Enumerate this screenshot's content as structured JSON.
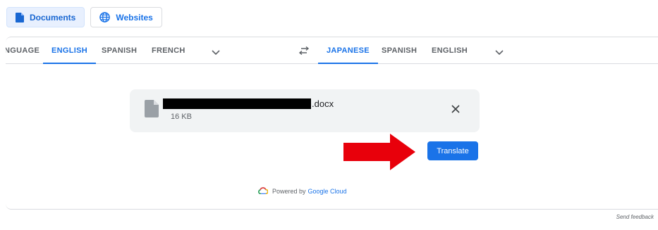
{
  "mode_tabs": {
    "documents_label": "Documents",
    "websites_label": "Websites"
  },
  "source_languages": {
    "detect_label": "NGUAGE",
    "items": [
      "ENGLISH",
      "SPANISH",
      "FRENCH"
    ],
    "selected": "ENGLISH"
  },
  "target_languages": {
    "items": [
      "JAPANESE",
      "SPANISH",
      "ENGLISH"
    ],
    "selected": "JAPANESE"
  },
  "file": {
    "name_suffix": ".docx",
    "size": "16 KB"
  },
  "actions": {
    "translate_label": "Translate"
  },
  "footer": {
    "powered_prefix": "Powered by",
    "powered_brand": "Google Cloud",
    "feedback_label": "Send feedback"
  },
  "colors": {
    "accent": "#1a73e8",
    "annotation_arrow": "#e8000b",
    "card_bg": "#f1f3f4",
    "redaction": "#000000"
  },
  "icons": [
    "document-icon",
    "globe-icon",
    "chevron-down-icon",
    "swap-icon",
    "file-icon",
    "close-icon",
    "google-cloud-icon",
    "red-arrow-annotation"
  ]
}
